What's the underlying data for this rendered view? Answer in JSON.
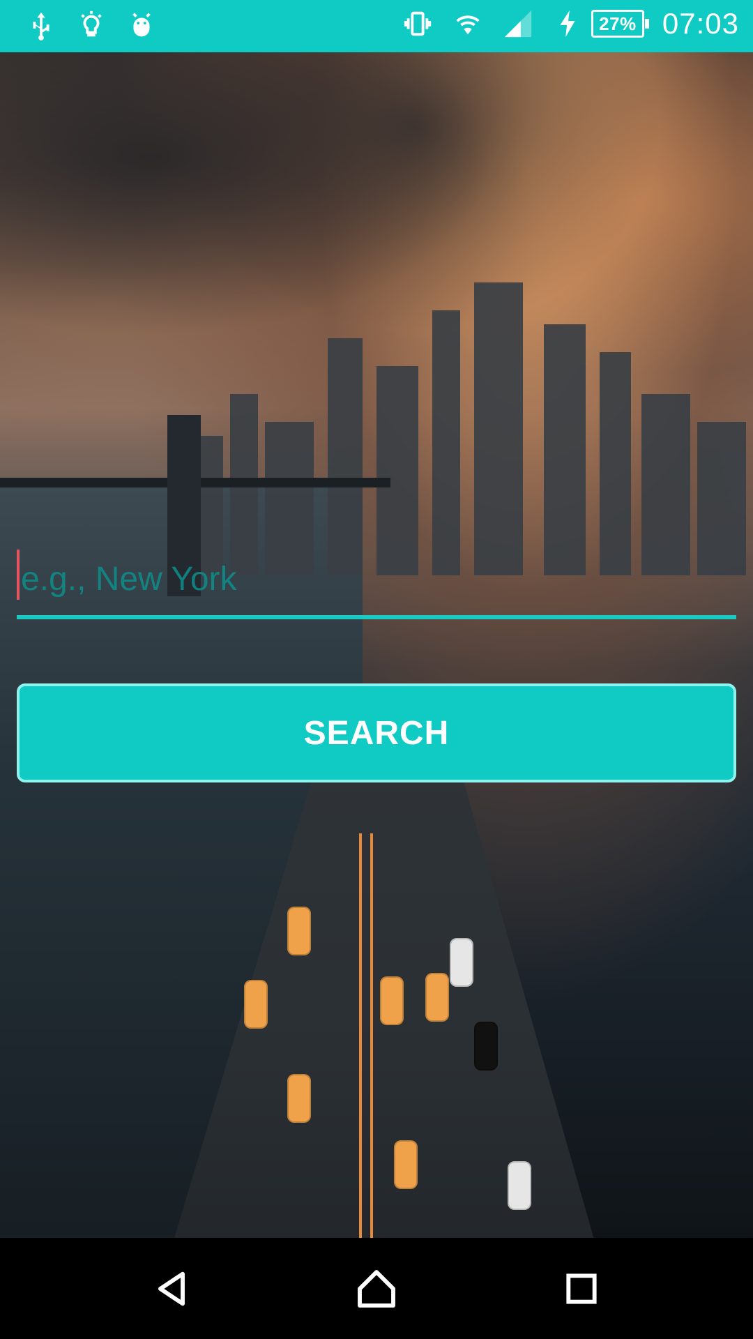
{
  "status_bar": {
    "left_icons": [
      "usb-icon",
      "lightbulb-icon",
      "android-debug-icon"
    ],
    "right_icons": [
      "vibrate-icon",
      "wifi-icon",
      "signal-icon",
      "charging-icon"
    ],
    "battery_percent": "27%",
    "time": "07:03"
  },
  "search": {
    "placeholder": "e.g., New York",
    "value": ""
  },
  "button": {
    "label": "SEARCH"
  },
  "nav": {
    "icons": [
      "back-icon",
      "home-icon",
      "recents-icon"
    ]
  },
  "colors": {
    "accent": "#10cbc4",
    "caret": "#e55561",
    "nav_bg": "#000000"
  }
}
